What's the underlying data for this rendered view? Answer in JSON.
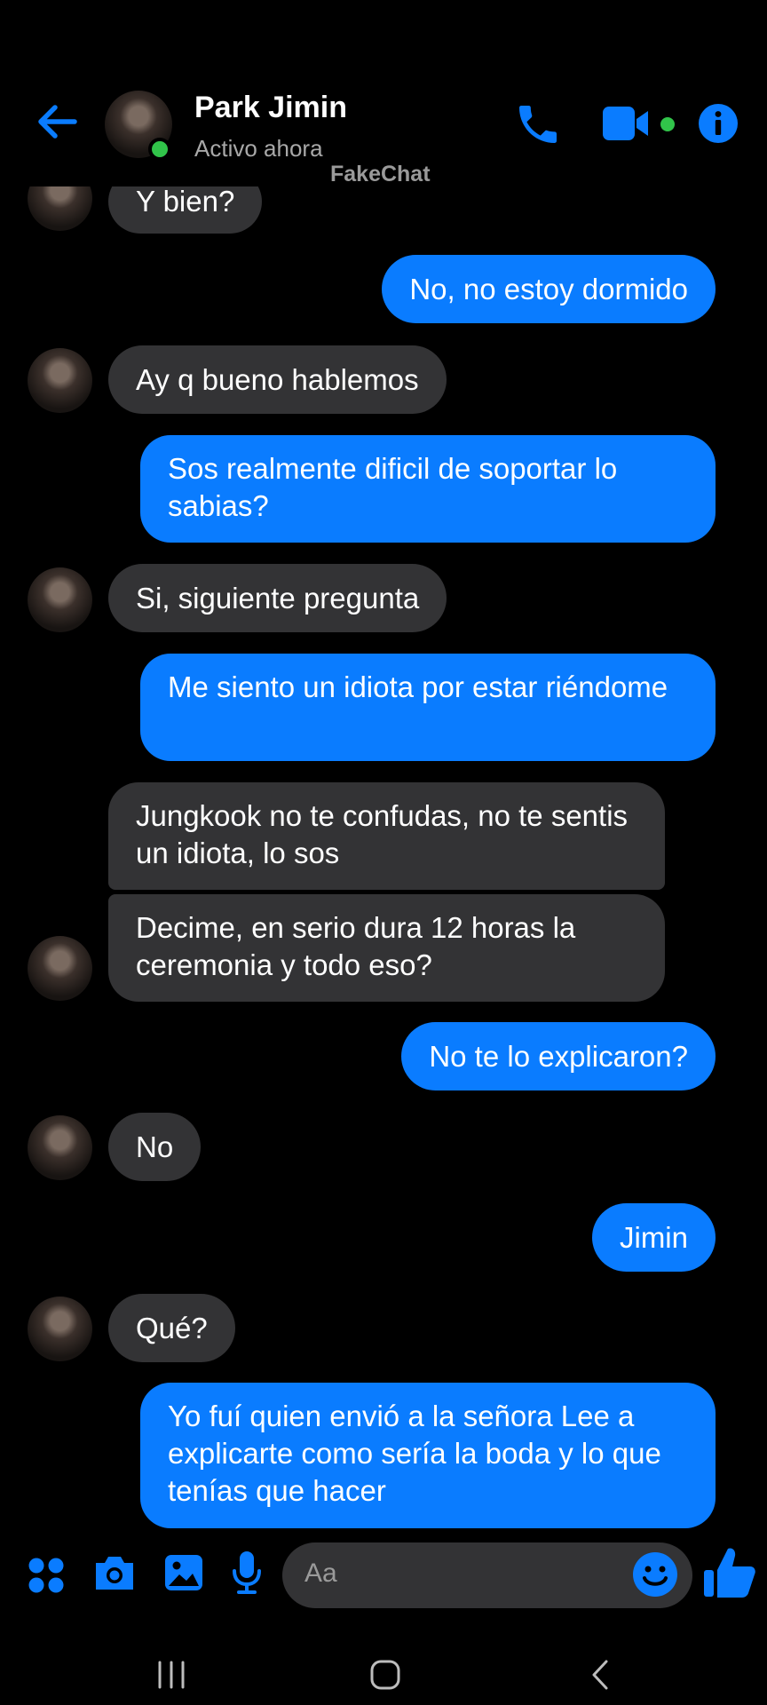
{
  "header": {
    "contact_name": "Park Jimin",
    "status": "Activo ahora",
    "watermark": "FakeChat"
  },
  "messages": [
    {
      "side": "in",
      "text": "Y bien?"
    },
    {
      "side": "out",
      "text": "No, no estoy dormido"
    },
    {
      "side": "in",
      "text": "Ay q bueno hablemos"
    },
    {
      "side": "out",
      "text": "Sos realmente dificil de soportar lo sabias?"
    },
    {
      "side": "in",
      "text": "Si, siguiente pregunta"
    },
    {
      "side": "out",
      "text": "Me siento un idiota por estar riéndome"
    },
    {
      "side": "in",
      "text": "Jungkook no te confudas, no te sentis un idiota, lo sos"
    },
    {
      "side": "in",
      "text": "Decime, en serio dura 12 horas la ceremonia y todo eso?"
    },
    {
      "side": "out",
      "text": "No te lo explicaron?"
    },
    {
      "side": "in",
      "text": "No"
    },
    {
      "side": "out",
      "text": "Jimin"
    },
    {
      "side": "in",
      "text": "Qué?"
    },
    {
      "side": "out",
      "text": "Yo fuí quien envió a la señora Lee a explicarte como sería la boda y lo que tenías que hacer"
    }
  ],
  "composer": {
    "placeholder": "Aa"
  },
  "colors": {
    "accent": "#0a7cff",
    "incoming_bubble": "#333335",
    "online": "#31c44a",
    "background": "#000000"
  },
  "icons": [
    "back-arrow-icon",
    "phone-icon",
    "video-camera-icon",
    "info-icon",
    "apps-grid-icon",
    "camera-icon",
    "gallery-icon",
    "microphone-icon",
    "emoji-icon",
    "thumbs-up-icon",
    "recent-apps-icon",
    "home-icon",
    "back-nav-icon"
  ]
}
